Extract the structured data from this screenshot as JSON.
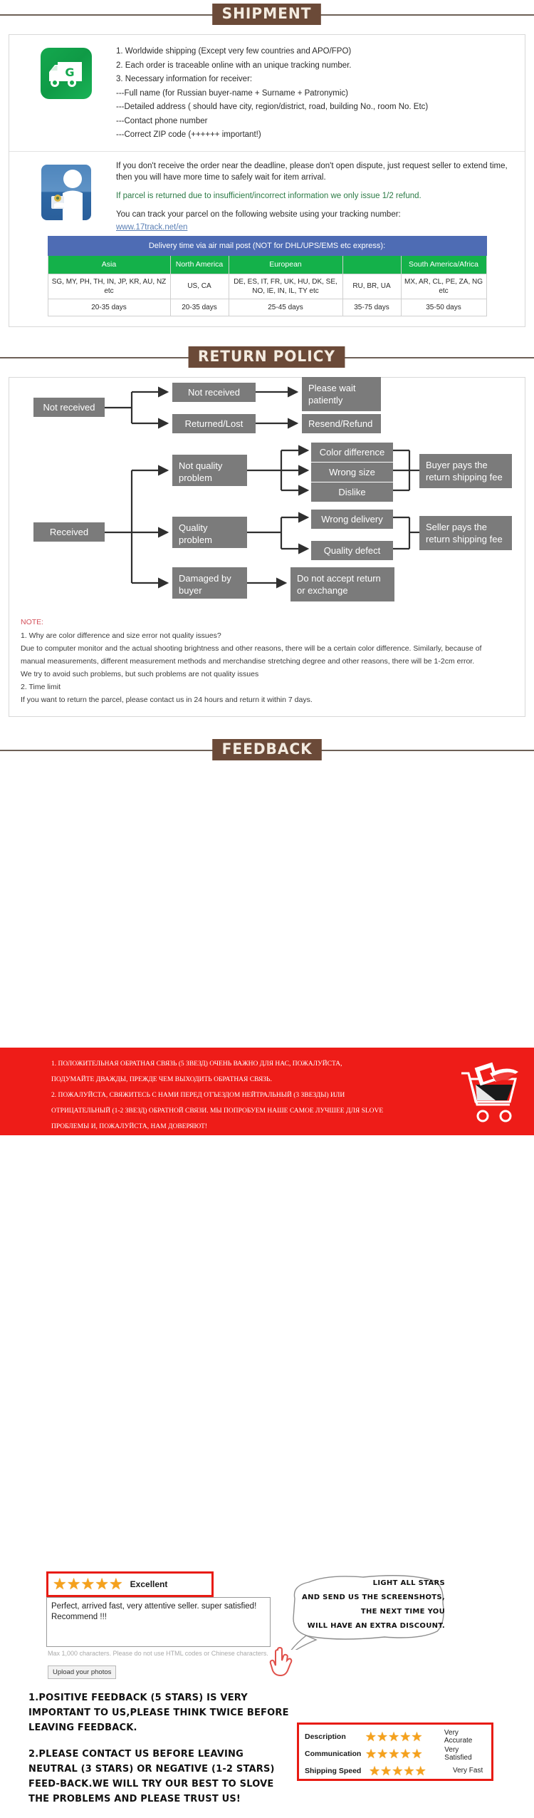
{
  "sections": {
    "shipment_title": "SHIPMENT",
    "return_title": "RETURN POLICY",
    "feedback_title": "FEEDBACK"
  },
  "shipment": {
    "icon": "delivery-truck-icon",
    "lines": [
      "1. Worldwide shipping (Except very few countries and APO/FPO)",
      "2. Each order is traceable online with an unique tracking number.",
      "3. Necessary information for receiver:",
      "---Full name (for Russian buyer-name + Surname + Patronymic)",
      "---Detailed address ( should have city, region/district, road, building No., room No. Etc)",
      "---Contact phone number",
      "---Correct ZIP code (++++++ important!)"
    ]
  },
  "tracking": {
    "icon": "parcel-handover-icon",
    "paragraph": "If you don't receive the order near the deadline, please don't open dispute, just request seller to extend time, then you will have more time to safely wait for item arrival.",
    "green_note": "If parcel is returned due to insufficient/incorrect information we only issue 1/2 refund.",
    "track_intro": "You can track your parcel on the following website using your tracking number:",
    "track_link": "www.17track.net/en"
  },
  "delivery_table": {
    "title": "Delivery time via air mail post (NOT for DHL/UPS/EMS etc express):",
    "headers": [
      "Asia",
      "North America",
      "European",
      "",
      "South America/Africa"
    ],
    "countries": [
      "SG, MY, PH, TH, IN, JP, KR, AU, NZ etc",
      "US, CA",
      "DE, ES, IT, FR, UK, HU, DK, SE, NO, IE, IN, IL, TY etc",
      "RU, BR, UA",
      "MX, AR, CL, PE, ZA, NG etc"
    ],
    "days": [
      "20-35 days",
      "20-35 days",
      "25-45 days",
      "35-75 days",
      "35-50 days"
    ],
    "header_color": "#14b14a",
    "title_color": "#4e6cb4"
  },
  "flowchart": {
    "nodes": {
      "not_received_root": "Not received",
      "not_received_2": "Not received",
      "returned_lost": "Returned/Lost",
      "please_wait": "Please wait patiently",
      "resend_refund": "Resend/Refund",
      "received_root": "Received",
      "not_quality_problem": "Not quality problem",
      "quality_problem": "Quality problem",
      "damaged_by_buyer": "Damaged by buyer",
      "color_difference": "Color difference",
      "wrong_size": "Wrong size",
      "dislike": "Dislike",
      "wrong_delivery": "Wrong delivery",
      "quality_defect": "Quality defect",
      "buyer_pays": "Buyer pays the return shipping fee",
      "seller_pays": "Seller pays the return shipping fee",
      "do_not_accept": "Do not accept return or exchange"
    },
    "node_color": "#7b7b7b"
  },
  "note": {
    "title": "NOTE:",
    "lines": [
      "1. Why are color difference and size error not quality issues?",
      "Due to computer monitor and the actual shooting brightness and other reasons, there will be a certain color difference. Similarly, because of",
      "manual measurements, different measurement methods and merchandise stretching degree and other reasons, there will be 1-2cm error.",
      "We try to avoid such problems, but such problems are not quality issues",
      "2. Time limit",
      "If you want to return the parcel, please contact us in 24 hours and return it within 7 days."
    ],
    "title_color": "#d4505a"
  },
  "feedback": {
    "stars_count": 5,
    "stars_label": "Excellent",
    "review_text": "Perfect, arrived fast, very attentive seller. super satisfied!\nRecommend !!!",
    "max_chars_hint": "Max 1,000 characters. Please do not use HTML codes or Chinese characters.",
    "upload_label": "Upload your photos",
    "bubble_lines": [
      "LIGHT ALL STARS",
      "AND SEND US THE SCREENSHOTS,",
      "THE NEXT TIME YOU",
      "WILL HAVE AN EXTRA DISCOUNT."
    ],
    "message_1": "1.POSITIVE FEEDBACK (5 STARS) IS VERY IMPORTANT TO US,PLEASE THINK TWICE BEFORE LEAVING FEEDBACK.",
    "message_2": "2.PLEASE CONTACT US BEFORE LEAVING NEUTRAL (3 STARS) OR NEGATIVE (1-2 STARS) FEED-BACK.WE WILL TRY OUR BEST TO SLOVE THE PROBLEMS AND PLEASE TRUST US!",
    "highlight_color": "#e81b13",
    "star_color": "#f5a11d",
    "ratings": [
      {
        "name": "Description",
        "stars": 5,
        "value": "Very Accurate"
      },
      {
        "name": "Communication",
        "stars": 5,
        "value": "Very Satisfied"
      },
      {
        "name": "Shipping Speed",
        "stars": 5,
        "value": "Very Fast"
      }
    ]
  },
  "footer": {
    "background": "#ee1c18",
    "icon": "shopping-cart-icon",
    "lines": [
      "1. ПОЛОЖИТЕЛЬНАЯ ОБРАТНАЯ СВЯЗЬ (5 ЗВЕЗД) ОЧЕНЬ ВАЖНО ДЛЯ НАС, ПОЖАЛУЙСТА,",
      "ПОДУМАЙТЕ ДВАЖДЫ, ПРЕЖДЕ ЧЕМ ВЫХОДИТЬ ОБРАТНАЯ СВЯЗЬ.",
      "2. ПОЖАЛУЙСТА, СВЯЖИТЕСЬ С НАМИ ПЕРЕД ОТЪЕЗДОМ НЕЙТРАЛЬНЫЙ (3 ЗВЕЗДЫ) ИЛИ",
      "ОТРИЦАТЕЛЬНЫЙ (1-2 ЗВЕЗД) ОБРАТНОЙ СВЯЗИ. МЫ ПОПРОБУЕМ НАШЕ САМОЕ ЛУЧШЕЕ ДЛЯ SLOVE",
      "ПРОБЛЕМЫ И, ПОЖАЛУЙСТА, НАМ ДОВЕРЯЮТ!"
    ]
  }
}
